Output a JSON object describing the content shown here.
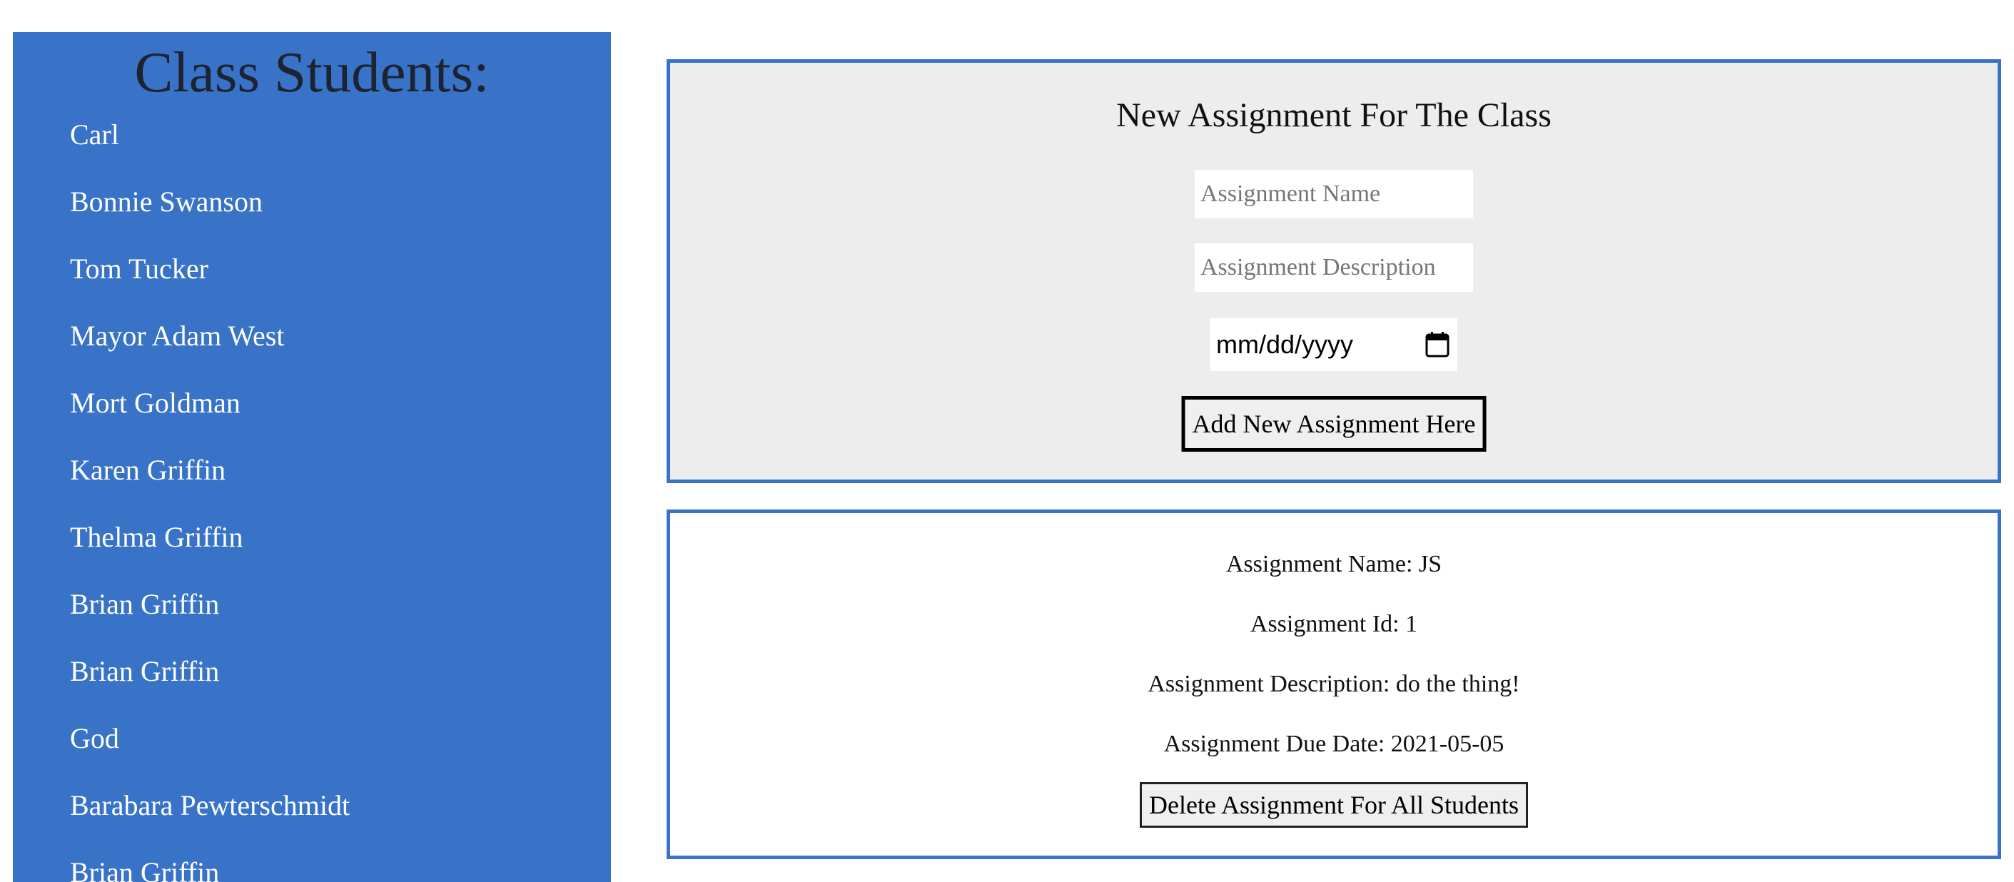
{
  "sidebar": {
    "title": "Class Students:",
    "students": [
      "Carl",
      "Bonnie Swanson",
      "Tom Tucker",
      "Mayor Adam West",
      "Mort Goldman",
      "Karen Griffin",
      "Thelma Griffin",
      "Brian Griffin",
      "Brian Griffin",
      "God",
      "Barabara Pewterschmidt",
      "Brian Griffin"
    ]
  },
  "new_assignment": {
    "title": "New Assignment For The Class",
    "name_placeholder": "Assignment Name",
    "description_placeholder": "Assignment Description",
    "date_placeholder": "mm/dd/yyyy",
    "add_button_label": "Add New Assignment Here"
  },
  "assignment": {
    "name_line": "Assignment Name: JS",
    "id_line": "Assignment Id: 1",
    "description_line": "Assignment Description: do the thing!",
    "due_date_line": "Assignment Due Date: 2021-05-05",
    "delete_button_label": "Delete Assignment For All Students"
  },
  "colors": {
    "sidebar_background": "#3873c7",
    "panel_border": "#3873c7",
    "form_background": "#ededed"
  },
  "icons": {
    "date_picker": "calendar-icon"
  }
}
